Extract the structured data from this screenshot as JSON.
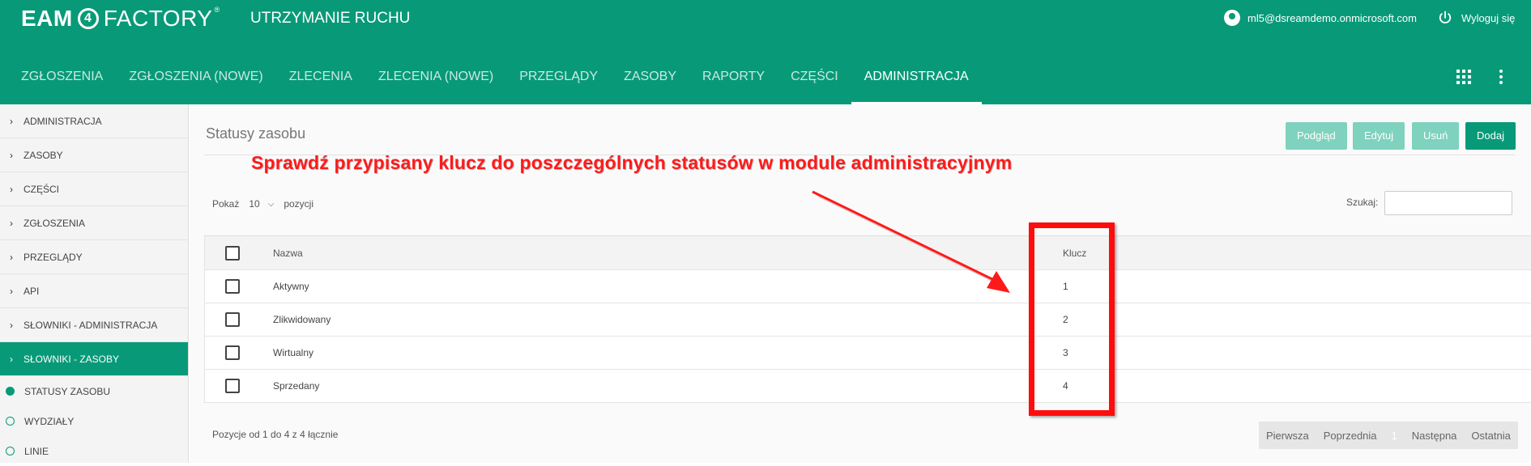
{
  "header": {
    "logo": {
      "part1": "EAM",
      "part2": "4",
      "part3": "FACTORY",
      "reg": "®"
    },
    "module_title": "UTRZYMANIE RUCHU",
    "user_email": "ml5@dsreamdemo.onmicrosoft.com",
    "logout_label": "Wyloguj się"
  },
  "nav": {
    "items": [
      {
        "label": "ZGŁOSZENIA"
      },
      {
        "label": "ZGŁOSZENIA (NOWE)"
      },
      {
        "label": "ZLECENIA"
      },
      {
        "label": "ZLECENIA (NOWE)"
      },
      {
        "label": "PRZEGLĄDY"
      },
      {
        "label": "ZASOBY"
      },
      {
        "label": "RAPORTY"
      },
      {
        "label": "CZĘŚCI"
      },
      {
        "label": "ADMINISTRACJA"
      }
    ],
    "active_index": 8
  },
  "sidebar": {
    "items": [
      {
        "label": "ADMINISTRACJA"
      },
      {
        "label": "ZASOBY"
      },
      {
        "label": "CZĘŚCI"
      },
      {
        "label": "ZGŁOSZENIA"
      },
      {
        "label": "PRZEGLĄDY"
      },
      {
        "label": "API"
      },
      {
        "label": "SŁOWNIKI - ADMINISTRACJA"
      },
      {
        "label": "SŁOWNIKI - ZASOBY"
      }
    ],
    "subitems": [
      {
        "label": "STATUSY ZASOBU"
      },
      {
        "label": "WYDZIAŁY"
      },
      {
        "label": "LINIE"
      }
    ]
  },
  "page": {
    "title": "Statusy zasobu",
    "buttons": {
      "preview": "Podgląd",
      "edit": "Edytuj",
      "delete": "Usuń",
      "add": "Dodaj"
    },
    "show_label": "Pokaż",
    "show_value": "10",
    "show_suffix": "pozycji",
    "search_label": "Szukaj:",
    "search_value": ""
  },
  "annotation": "Sprawdź przypisany klucz do poszczególnych statusów w module administracyjnym",
  "table": {
    "headers": {
      "name": "Nazwa",
      "key": "Klucz"
    },
    "rows": [
      {
        "name": "Aktywny",
        "key": "1"
      },
      {
        "name": "Zlikwidowany",
        "key": "2"
      },
      {
        "name": "Wirtualny",
        "key": "3"
      },
      {
        "name": "Sprzedany",
        "key": "4"
      }
    ]
  },
  "footer": {
    "info": "Pozycje od 1 do 4 z 4 łącznie",
    "pager": {
      "first": "Pierwsza",
      "prev": "Poprzednia",
      "current": "1",
      "next": "Następna",
      "last": "Ostatnia"
    }
  },
  "colors": {
    "brand": "#089a78",
    "brand_light": "#7fd2bd",
    "annotation": "#ff1a1a"
  },
  "icons": {
    "user": "account-circle-icon",
    "logout": "power-icon",
    "apps": "apps-grid-icon",
    "more": "more-vert-icon",
    "chevron": "chevron-right-icon",
    "dropdown": "chevron-down-icon"
  }
}
